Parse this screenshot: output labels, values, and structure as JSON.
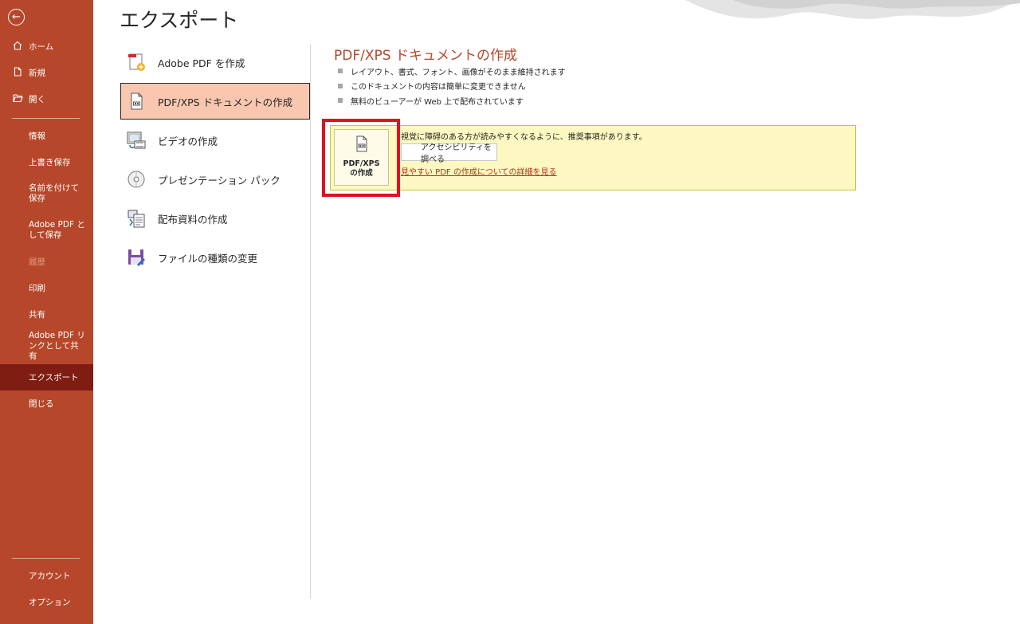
{
  "sidebar": {
    "back_icon": "back-arrow-icon",
    "top_items": [
      {
        "label": "ホーム",
        "icon": "home-icon"
      },
      {
        "label": "新規",
        "icon": "new-document-icon"
      },
      {
        "label": "開く",
        "icon": "open-folder-icon"
      }
    ],
    "mid_items": [
      {
        "label": "情報"
      },
      {
        "label": "上書き保存"
      },
      {
        "label": "名前を付けて保存"
      },
      {
        "label": "Adobe PDF として保存"
      },
      {
        "label": "履歴"
      },
      {
        "label": "印刷"
      },
      {
        "label": "共有"
      },
      {
        "label": "Adobe PDF リンクとして共有"
      },
      {
        "label": "エクスポート"
      },
      {
        "label": "閉じる"
      }
    ],
    "bottom_items": [
      {
        "label": "アカウント"
      },
      {
        "label": "オプション"
      }
    ]
  },
  "page_title": "エクスポート",
  "options": [
    {
      "label": "Adobe PDF を作成",
      "icon": "adobe-pdf-icon"
    },
    {
      "label": "PDF/XPS ドキュメントの作成",
      "icon": "pdf-xps-document-icon"
    },
    {
      "label": "ビデオの作成",
      "icon": "video-icon"
    },
    {
      "label": "プレゼンテーション パック",
      "icon": "cd-package-icon"
    },
    {
      "label": "配布資料の作成",
      "icon": "handouts-icon"
    },
    {
      "label": "ファイルの種類の変更",
      "icon": "save-file-type-icon"
    }
  ],
  "pane": {
    "title": "PDF/XPS ドキュメントの作成",
    "bullets": [
      "レイアウト、書式、フォント、画像がそのまま維持されます",
      "このドキュメントの内容は簡単に変更できません",
      "無料のビューアーが Web 上で配布されています"
    ],
    "create_button_label": "PDF/XPS\nの作成",
    "accessibility_text": "視覚に障碍のある方が読みやすくなるように、推奨事項があります。",
    "accessibility_button": "アクセシビリティを調べる",
    "accessibility_link": "見やすい PDF の作成についての詳細を見る"
  },
  "colors": {
    "accent": "#b7472a",
    "active_nav": "#7f1d12",
    "selected_option": "#f9c7b0",
    "highlight_frame": "#e01020",
    "notice_bg": "#fdf8c1"
  }
}
